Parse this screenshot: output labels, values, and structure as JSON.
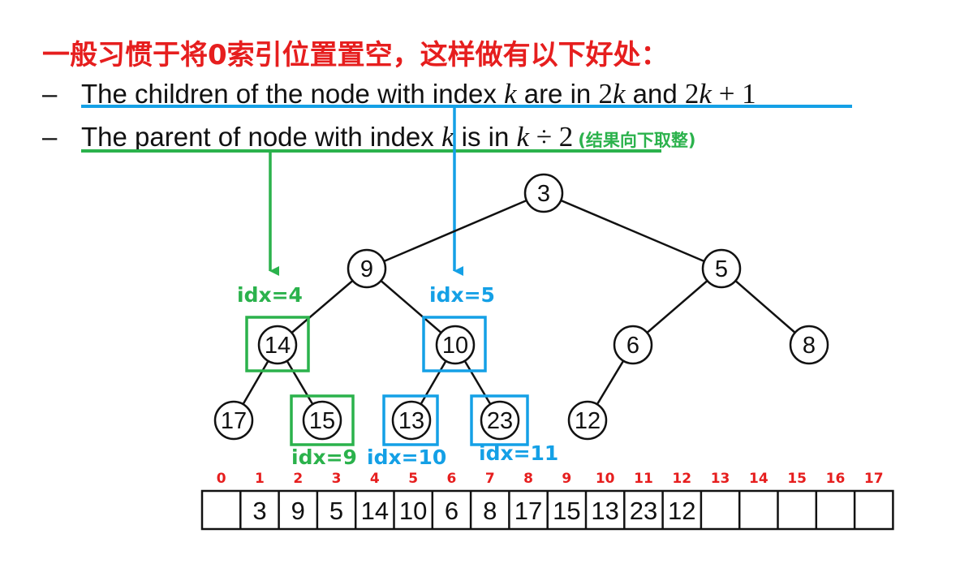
{
  "title": "一般习惯于将0索引位置置空，这样做有以下好处：",
  "bullets": {
    "dash": "–",
    "line1": {
      "text_a": "The children of the node with index ",
      "k1": "k",
      "text_b": " are in ",
      "expr1_num": "2",
      "expr1_var": "k",
      "text_c": " and ",
      "expr2_num": "2",
      "expr2_var": "k",
      "expr2_rest": " + 1"
    },
    "line2": {
      "text_a": "The parent of node with index ",
      "k1": "k",
      "text_b": " is in ",
      "expr_var": "k",
      "expr_rest": " ÷ 2",
      "note": "(结果向下取整)"
    }
  },
  "colors": {
    "title_red": "#e61e1e",
    "green": "#2bb24c",
    "blue": "#14a0e6",
    "index_red": "#e61e1e"
  },
  "tree": {
    "nodes": [
      {
        "id": "n1",
        "value": "3"
      },
      {
        "id": "n2",
        "value": "9"
      },
      {
        "id": "n3",
        "value": "5"
      },
      {
        "id": "n4",
        "value": "14"
      },
      {
        "id": "n5",
        "value": "10"
      },
      {
        "id": "n6",
        "value": "6"
      },
      {
        "id": "n7",
        "value": "8"
      },
      {
        "id": "n8",
        "value": "17"
      },
      {
        "id": "n9",
        "value": "15"
      },
      {
        "id": "n10",
        "value": "13"
      },
      {
        "id": "n11",
        "value": "23"
      },
      {
        "id": "n12",
        "value": "12"
      }
    ],
    "edges": [
      [
        "n1",
        "n2"
      ],
      [
        "n1",
        "n3"
      ],
      [
        "n2",
        "n4"
      ],
      [
        "n2",
        "n5"
      ],
      [
        "n3",
        "n6"
      ],
      [
        "n3",
        "n7"
      ],
      [
        "n4",
        "n8"
      ],
      [
        "n4",
        "n9"
      ],
      [
        "n5",
        "n10"
      ],
      [
        "n5",
        "n11"
      ],
      [
        "n6",
        "n12"
      ]
    ],
    "highlights": [
      {
        "node": "n4",
        "color": "green",
        "label": "idx=4"
      },
      {
        "node": "n9",
        "color": "green",
        "label": "idx=9"
      },
      {
        "node": "n5",
        "color": "blue",
        "label": "idx=5"
      },
      {
        "node": "n10",
        "color": "blue",
        "label": "idx=10"
      },
      {
        "node": "n11",
        "color": "blue",
        "label": "idx=11"
      }
    ]
  },
  "array": {
    "indices": [
      "0",
      "1",
      "2",
      "3",
      "4",
      "5",
      "6",
      "7",
      "8",
      "9",
      "10",
      "11",
      "12",
      "13",
      "14",
      "15",
      "16",
      "17"
    ],
    "values": [
      "",
      "3",
      "9",
      "5",
      "14",
      "10",
      "6",
      "8",
      "17",
      "15",
      "13",
      "23",
      "12",
      "",
      "",
      "",
      "",
      ""
    ]
  }
}
